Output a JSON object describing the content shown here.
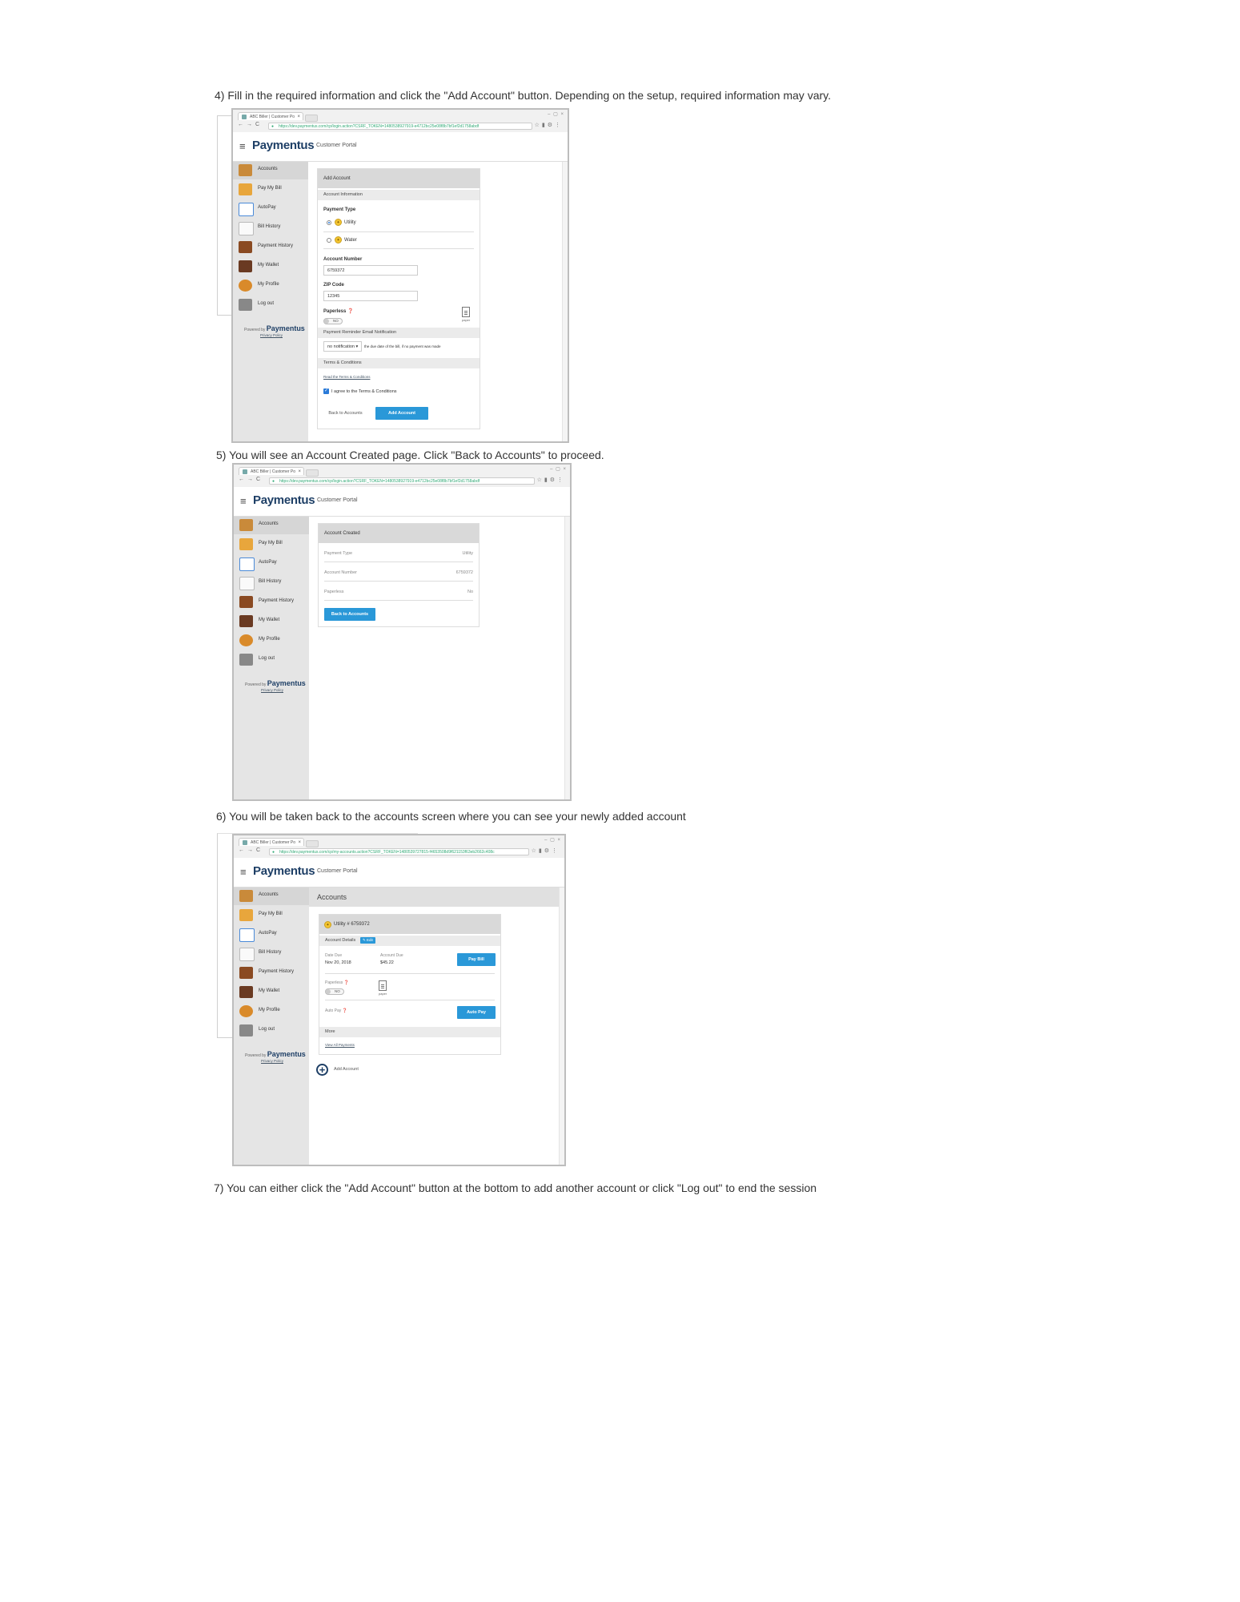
{
  "steps": {
    "s4": "4) Fill in the required information and click the \"Add  Account\" button.  Depending on the setup, required information may vary.",
    "s5": "5) You will see an Account Created page.  Click \"Back to Accounts\" to proceed.",
    "s6": "6) You will be taken back to the accounts screen where you can see your newly added account",
    "s7": "7) You can either click the \"Add Account\" button at the bottom to add another account or click \"Log out\" to end the session"
  },
  "browser": {
    "tab_title": "ABC Biller | Customer Po",
    "url_login": "https://dev.paymentus.com/cp/login.action?CSRF_TOKEN=1480538927919-e4712bc25e08f8b7bf1ef2d1758abdf",
    "url_accounts": "https://dev.paymentus.com/cp/my-accounts.action?CSRF_TOKEN=1480539727815-f4653508d9f621153f63eb2662c408c"
  },
  "app": {
    "logo": "Paymentus",
    "portal": "Customer Portal",
    "powered_by": "Powered by",
    "powered_logo": "Paymentus",
    "privacy": "Privacy Policy",
    "nav": [
      "Accounts",
      "Pay My Bill",
      "AutoPay",
      "Bill History",
      "Payment History",
      "My Wallet",
      "My Profile",
      "Log out"
    ]
  },
  "add_account": {
    "title": "Add Account",
    "section_info": "Account Information",
    "payment_type_label": "Payment Type",
    "option_utility": "Utility",
    "option_water": "Water",
    "account_number_label": "Account Number",
    "account_number_value": "6759372",
    "zip_label": "ZIP Code",
    "zip_value": "12345",
    "paperless_label": "Paperless",
    "toggle_no": "NO",
    "paper_label": "paper",
    "section_reminder": "Payment Reminder Email Notification",
    "reminder_select": "no notification",
    "reminder_text": "the due date of the bill, if no payment was made",
    "section_terms": "Terms & Conditions",
    "read_terms": "Read the Terms & Conditions",
    "agree": "I agree to the Terms & Conditions",
    "back_btn": "Back to Accounts",
    "add_btn": "Add Account"
  },
  "created": {
    "title": "Account Created",
    "rows": [
      {
        "label": "Payment Type",
        "value": "Utility"
      },
      {
        "label": "Account Number",
        "value": "6759372"
      },
      {
        "label": "Paperless",
        "value": "No"
      }
    ],
    "back_btn": "Back to Accounts"
  },
  "accounts": {
    "heading": "Accounts",
    "card_title": "Utility # 6759372",
    "details": "Account Details",
    "edit": "Edit",
    "date_due_label": "Date Due",
    "date_due_value": "Nov 20, 2018",
    "amount_due_label": "Account Due",
    "amount_due_value": "$45.22",
    "pay_bill": "Pay Bill",
    "paperless": "Paperless",
    "toggle_no": "NO",
    "paper_label": "paper",
    "autopay_label": "Auto Pay",
    "autopay_btn": "Auto Pay",
    "more": "More",
    "view_payments": "View All Payments",
    "add_account": "Add Account"
  }
}
